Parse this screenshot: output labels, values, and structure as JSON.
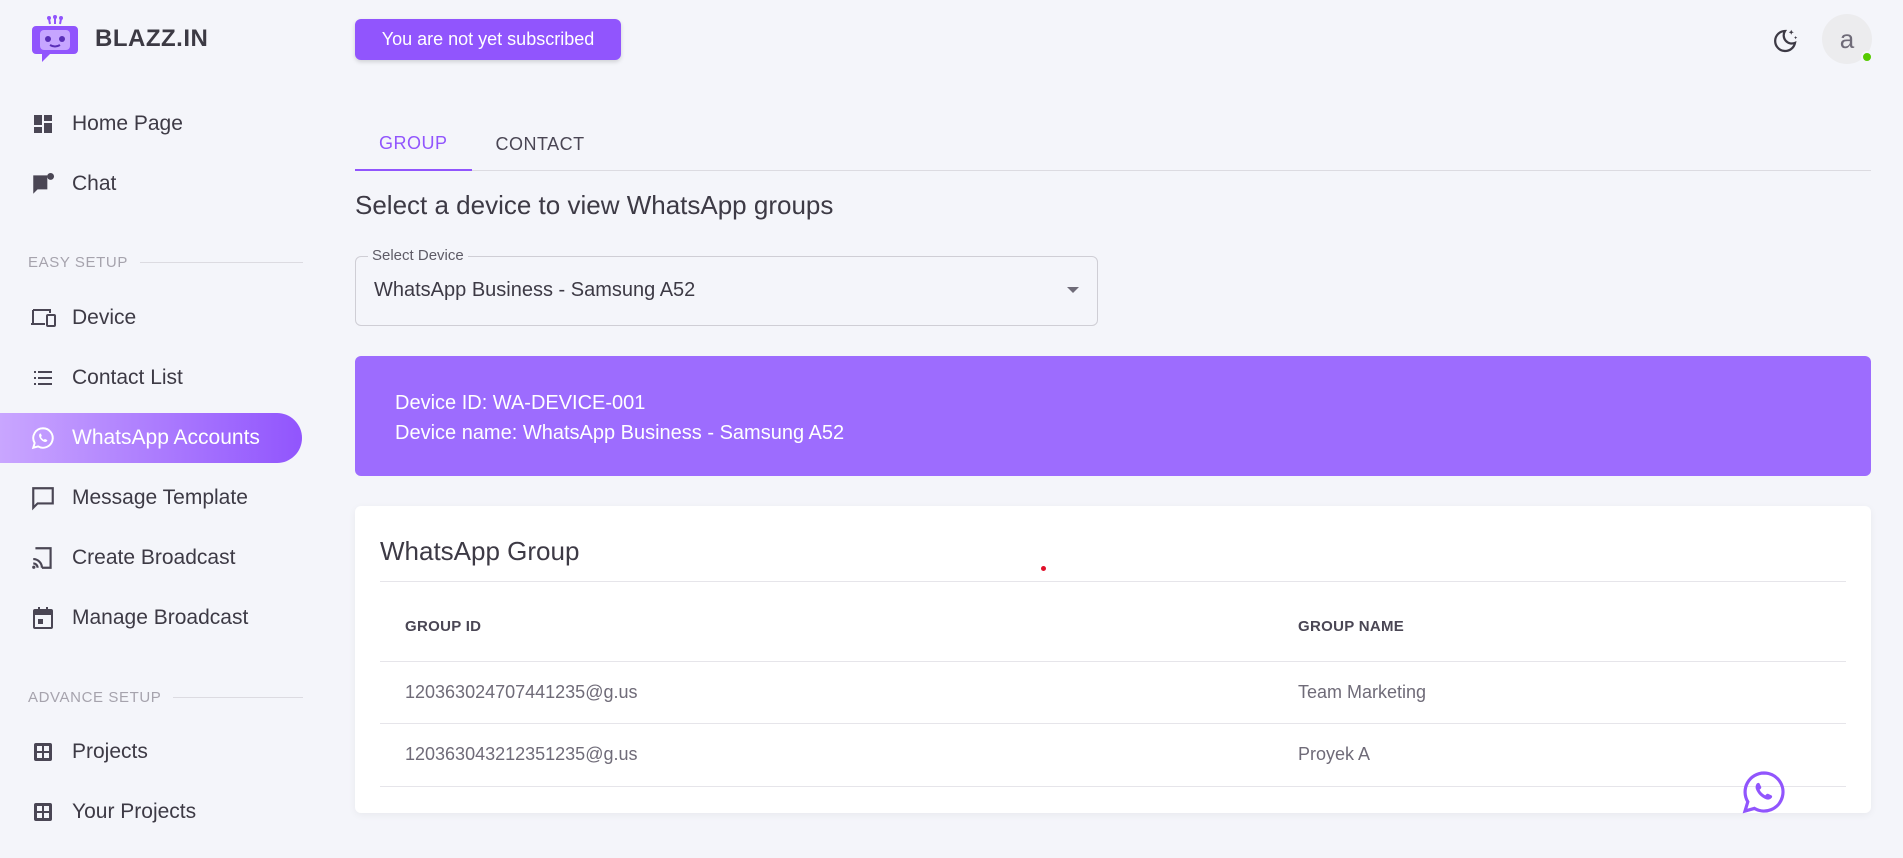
{
  "brand": {
    "name": "BLAZZ.IN"
  },
  "sidebar": {
    "items_top": [
      {
        "label": "Home Page",
        "icon": "dashboard-icon"
      },
      {
        "label": "Chat",
        "icon": "chat-icon"
      }
    ],
    "section_easy": "EASY SETUP",
    "items_easy": [
      {
        "label": "Device",
        "icon": "devices-icon"
      },
      {
        "label": "Contact List",
        "icon": "list-icon"
      },
      {
        "label": "WhatsApp Accounts",
        "icon": "whatsapp-icon"
      },
      {
        "label": "Message Template",
        "icon": "message-icon"
      },
      {
        "label": "Create Broadcast",
        "icon": "cast-icon"
      },
      {
        "label": "Manage Broadcast",
        "icon": "calendar-icon"
      }
    ],
    "section_advance": "ADVANCE SETUP",
    "items_advance": [
      {
        "label": "Projects",
        "icon": "grid-icon"
      },
      {
        "label": "Your Projects",
        "icon": "grid-icon"
      }
    ],
    "active_item": "WhatsApp Accounts"
  },
  "topbar": {
    "subscription_notice": "You are not yet subscribed",
    "avatar_letter": "a"
  },
  "tabs": [
    {
      "label": "GROUP",
      "active": true
    },
    {
      "label": "CONTACT",
      "active": false
    }
  ],
  "heading": "Select a device to view WhatsApp groups",
  "device_select": {
    "label": "Select Device",
    "value": "WhatsApp Business - Samsung A52"
  },
  "device_info": {
    "id_line": "Device ID: WA-DEVICE-001",
    "name_line": "Device name: WhatsApp Business - Samsung A52"
  },
  "group_table": {
    "title": "WhatsApp Group",
    "columns": [
      "GROUP ID",
      "GROUP NAME"
    ],
    "rows": [
      [
        "120363024707441235@g.us",
        "Team Marketing"
      ],
      [
        "120363043212351235@g.us",
        "Proyek A"
      ]
    ]
  },
  "colors": {
    "accent": "#9155fd",
    "panel": "#9d6cfe",
    "online": "#56ca00"
  }
}
